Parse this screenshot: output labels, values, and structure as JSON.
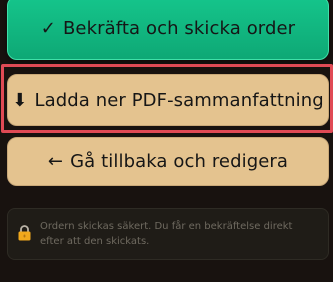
{
  "actions": {
    "confirm": {
      "icon": "checkmark-icon",
      "icon_glyph": "✓",
      "label": "Bekräfta och skicka order"
    },
    "download": {
      "icon": "down-arrow-icon",
      "icon_glyph": "⬇",
      "label": "Ladda ner PDF-sammanfattning"
    },
    "back": {
      "icon": "left-arrow-icon",
      "icon_glyph": "←",
      "label": "Gå tillbaka och redigera"
    }
  },
  "notice": {
    "icon": "lock-icon",
    "text": "Ordern skickas säkert. Du får en bekräftelse direkt efter att den skickats."
  },
  "colors": {
    "confirm_bg": "#12b882",
    "secondary_bg": "#e4c38f",
    "highlight": "#e04a55",
    "page_bg": "#18120f"
  }
}
